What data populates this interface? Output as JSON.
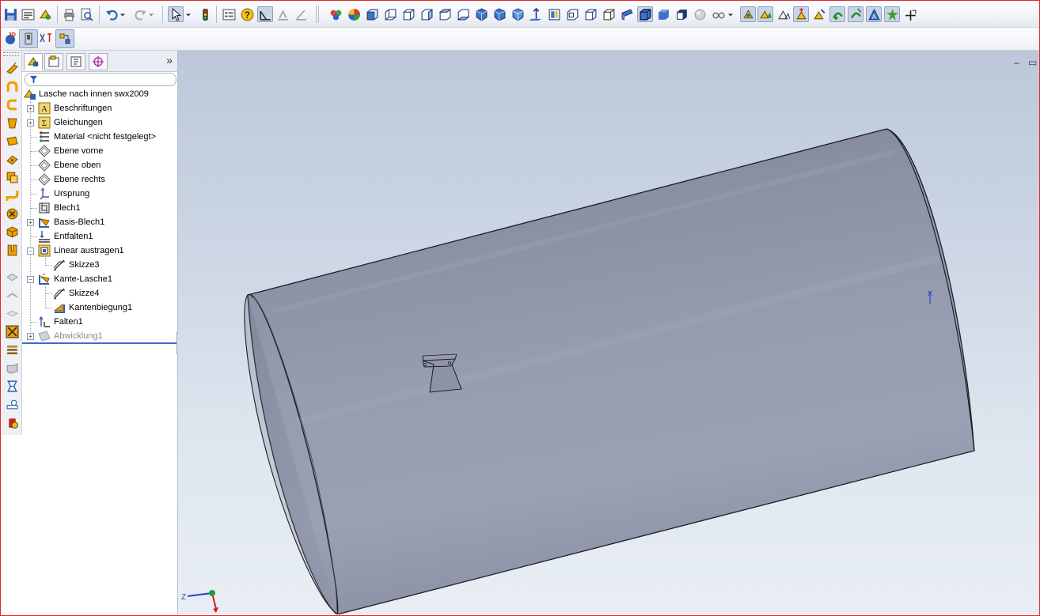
{
  "toolbar": {
    "standard": [
      "save-icon",
      "properties-icon",
      "rebuild-icon",
      "print-icon",
      "print-preview-icon",
      "undo-icon",
      "redo-icon",
      "select-icon",
      "traffic-light-icon",
      "options-icon",
      "help-icon"
    ],
    "sketch": [
      "smart-dimension-icon",
      "sketch-icon"
    ],
    "view": [
      "appearance-icon",
      "color-icon",
      "view-front-icon",
      "view-back-icon",
      "view-left-icon",
      "view-right-icon",
      "view-top-icon",
      "view-bottom-icon",
      "isometric-icon",
      "trimetric-icon",
      "dimetric-icon",
      "normal-to-icon",
      "single-view-icon",
      "two-view-icon",
      "four-view-icon",
      "wireframe-icon",
      "hidden-lines-visible-icon",
      "hidden-lines-removed-icon",
      "shaded-with-edges-icon",
      "shaded-icon",
      "shadows-icon",
      "perspective-icon",
      "section-view-icon",
      "zoom-to-fit-icon",
      "zoom-area-icon",
      "zoom-inout-icon",
      "rotate-icon",
      "pan-icon",
      "roll-view-icon",
      "3d-drawing-view-icon",
      "display-pane-icon",
      "view-orientation-icon",
      "previous-view-icon",
      "hide-show-icon"
    ]
  },
  "toolbar2": {
    "items": [
      "3d-content-icon",
      "sheet-metal-toolbar-icon",
      "dimxpert-icon",
      "sketch-relations-icon"
    ]
  },
  "vertical_toolbar": {
    "items": [
      "base-flange-icon",
      "edge-flange-icon",
      "miter-flange-icon",
      "hem-icon",
      "tab-icon",
      "jog-icon",
      "sketched-bend-icon",
      "lofted-bend-icon",
      "closed-corner-icon",
      "break-corner-icon",
      "rip-icon",
      "unfold-icon",
      "fold-icon",
      "flatten-icon",
      "no-bends-icon",
      "insert-bends-icon",
      "forming-tool-icon",
      "vent-icon",
      "cut-list-icon",
      "measure-icon",
      "mass-properties-icon",
      "section-properties-icon"
    ]
  },
  "feature_manager": {
    "tabs": [
      "featuremanager-tab",
      "propertymanager-tab",
      "configurationmanager-tab",
      "dimxpert-tab"
    ],
    "more": "»",
    "root": "Lasche nach innen swx2009",
    "items": [
      {
        "label": "Beschriftungen",
        "icon": "annotations-icon",
        "expandable": true,
        "level": 1
      },
      {
        "label": "Gleichungen",
        "icon": "equations-icon",
        "expandable": true,
        "level": 1
      },
      {
        "label": "Material <nicht festgelegt>",
        "icon": "material-icon",
        "expandable": false,
        "level": 1
      },
      {
        "label": "Ebene vorne",
        "icon": "plane-icon",
        "expandable": false,
        "level": 1
      },
      {
        "label": "Ebene oben",
        "icon": "plane-icon",
        "expandable": false,
        "level": 1
      },
      {
        "label": "Ebene rechts",
        "icon": "plane-icon",
        "expandable": false,
        "level": 1
      },
      {
        "label": "Ursprung",
        "icon": "origin-icon",
        "expandable": false,
        "level": 1
      },
      {
        "label": "Blech1",
        "icon": "sheet-metal-icon",
        "expandable": false,
        "level": 1
      },
      {
        "label": "Basis-Blech1",
        "icon": "base-flange-feature-icon",
        "expandable": true,
        "level": 1
      },
      {
        "label": "Entfalten1",
        "icon": "unfold-feature-icon",
        "expandable": false,
        "level": 1
      },
      {
        "label": "Linear austragen1",
        "icon": "extrude-icon",
        "expandable": true,
        "expanded": true,
        "level": 1
      },
      {
        "label": "Skizze3",
        "icon": "sketch-feature-icon",
        "expandable": false,
        "level": 2
      },
      {
        "label": "Kante-Lasche1",
        "icon": "edge-flange-feature-icon",
        "expandable": true,
        "expanded": true,
        "level": 1
      },
      {
        "label": "Skizze4",
        "icon": "sketch-feature-icon",
        "expandable": false,
        "level": 2
      },
      {
        "label": "Kantenbiegung1",
        "icon": "bend-icon",
        "expandable": false,
        "level": 2
      },
      {
        "label": "Falten1",
        "icon": "fold-feature-icon",
        "expandable": false,
        "level": 1
      },
      {
        "label": "Abwicklung1",
        "icon": "flat-pattern-icon",
        "expandable": true,
        "level": 1,
        "suppressed": true
      }
    ]
  },
  "viewport": {
    "window_controls": [
      "minimize-icon",
      "restore-icon"
    ],
    "triad_labels": {
      "z": "Z"
    }
  },
  "colors": {
    "frame": "#e2262a",
    "cylinder": "#8d93a6",
    "accent": "#3a6fc4"
  }
}
